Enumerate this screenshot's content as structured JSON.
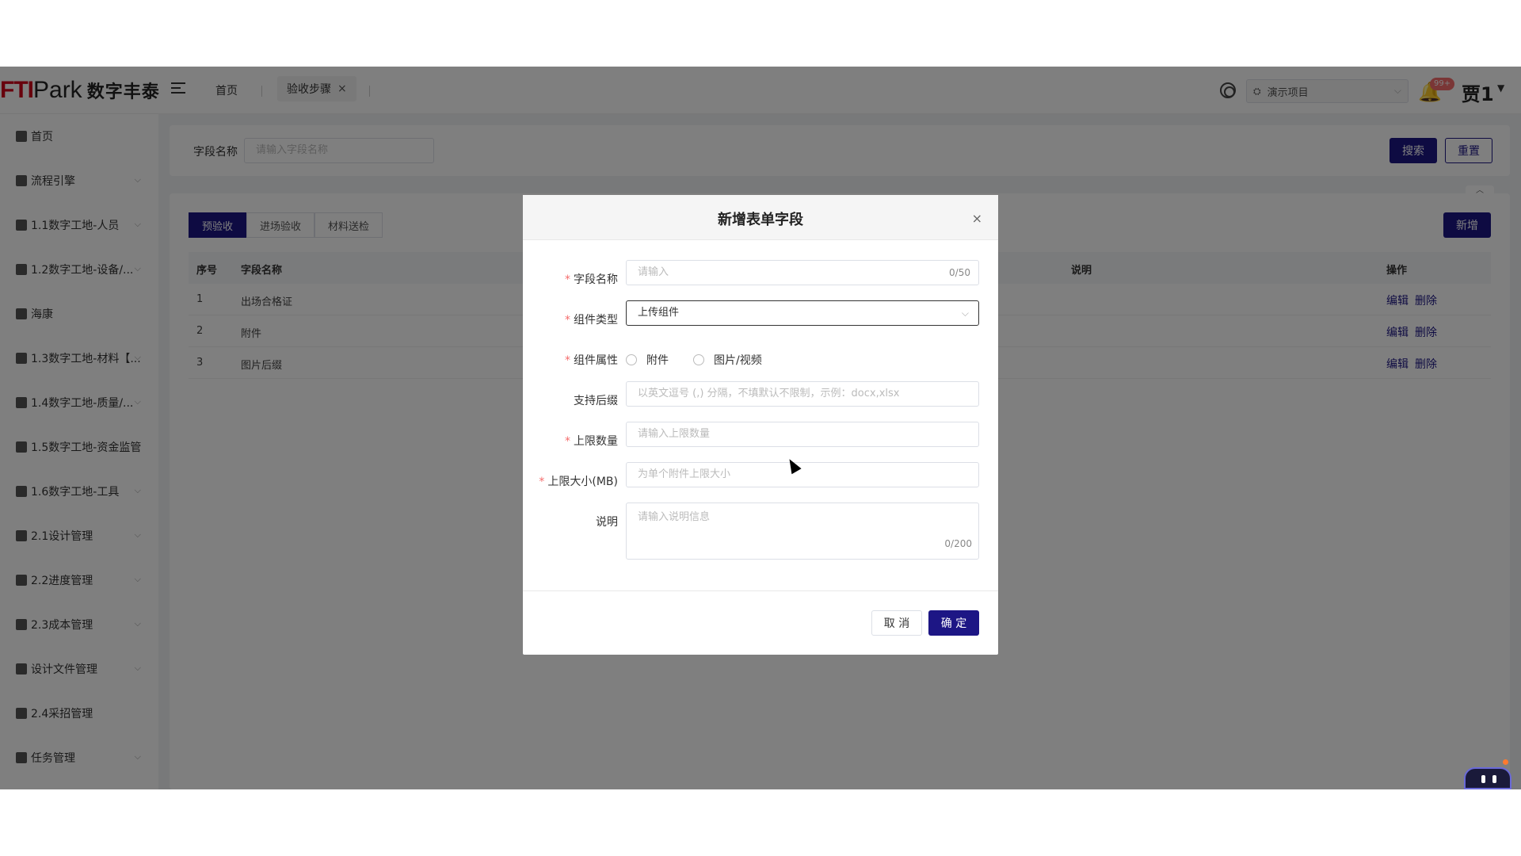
{
  "logo": {
    "ft": "FTI",
    "park": "Park",
    "cn": "数字丰泰"
  },
  "header": {
    "tab_home": "首页",
    "tab_active": "验收步骤",
    "tab_close": "×",
    "project_select": "演示项目",
    "notification_badge": "99+",
    "username": "贾1"
  },
  "sidebar": {
    "items": [
      {
        "label": "首页",
        "icon": "home-icon",
        "expandable": false
      },
      {
        "label": "流程引擎",
        "icon": "flow-icon",
        "expandable": true
      },
      {
        "label": "1.1数字工地-人员",
        "icon": "people-icon",
        "expandable": true
      },
      {
        "label": "1.2数字工地-设备/...",
        "icon": "doc-icon",
        "expandable": true
      },
      {
        "label": "海康",
        "icon": "doc-icon",
        "expandable": false
      },
      {
        "label": "1.3数字工地-材料【...",
        "icon": "doc-icon",
        "expandable": true
      },
      {
        "label": "1.4数字工地-质量/...",
        "icon": "doc-icon",
        "expandable": true
      },
      {
        "label": "1.5数字工地-资金监管",
        "icon": "shield-icon",
        "expandable": false
      },
      {
        "label": "1.6数字工地-工具",
        "icon": "doc-icon",
        "expandable": true
      },
      {
        "label": "2.1设计管理",
        "icon": "doc-icon",
        "expandable": true
      },
      {
        "label": "2.2进度管理",
        "icon": "progress-icon",
        "expandable": true
      },
      {
        "label": "2.3成本管理",
        "icon": "doc-icon",
        "expandable": true
      },
      {
        "label": "设计文件管理",
        "icon": "doc-icon",
        "expandable": true
      },
      {
        "label": "2.4采招管理",
        "icon": "doc-icon",
        "expandable": false
      },
      {
        "label": "任务管理",
        "icon": "task-icon",
        "expandable": true
      }
    ]
  },
  "search": {
    "label": "字段名称",
    "placeholder": "请输入字段名称",
    "search_btn": "搜索",
    "reset_btn": "重置"
  },
  "table": {
    "subtabs": [
      "预验收",
      "进场验收",
      "材料送检"
    ],
    "active_subtab": 0,
    "add_btn": "新增",
    "columns": [
      "序号",
      "字段名称",
      "说明",
      "操作"
    ],
    "rows": [
      {
        "no": "1",
        "name": "出场合格证"
      },
      {
        "no": "2",
        "name": "附件"
      },
      {
        "no": "3",
        "name": "图片后缀"
      }
    ],
    "edit_label": "编辑",
    "delete_label": "删除"
  },
  "dialog": {
    "title": "新增表单字段",
    "close": "×",
    "field_name": {
      "label": "字段名称",
      "placeholder": "请输入",
      "count": "0/50"
    },
    "component_type": {
      "label": "组件类型",
      "value": "上传组件"
    },
    "component_attr": {
      "label": "组件属性",
      "options": [
        "附件",
        "图片/视频"
      ]
    },
    "suffix": {
      "label": "支持后缀",
      "placeholder": "以英文逗号 (,) 分隔，不填默认不限制，示例：docx,xlsx"
    },
    "max_count": {
      "label": "上限数量",
      "placeholder": "请输入上限数量"
    },
    "max_size": {
      "label": "上限大小(MB)",
      "placeholder": "为单个附件上限大小"
    },
    "desc": {
      "label": "说明",
      "placeholder": "请输入说明信息",
      "count": "0/200"
    },
    "cancel": "取 消",
    "confirm": "确 定"
  }
}
